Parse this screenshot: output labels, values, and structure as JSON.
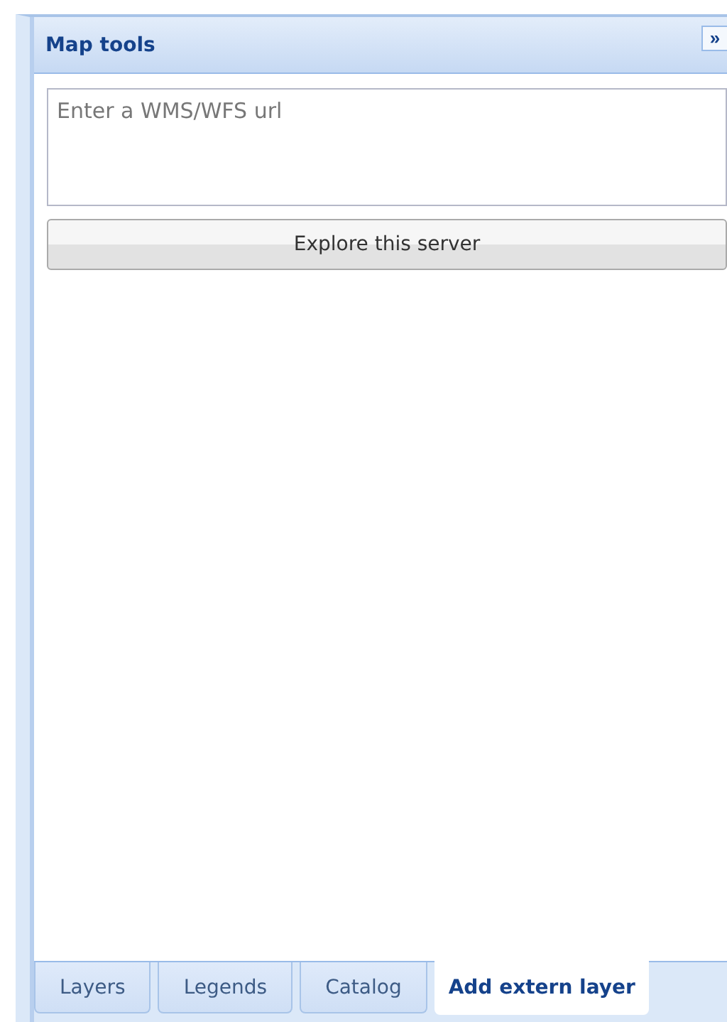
{
  "panel": {
    "title": "Map tools",
    "collapse_icon": "»"
  },
  "url_field": {
    "placeholder": "Enter a WMS/WFS url"
  },
  "explore_button": {
    "label": "Explore this server"
  },
  "tabs": [
    {
      "label": "Layers",
      "selected": false
    },
    {
      "label": "Legends",
      "selected": false
    },
    {
      "label": "Catalog",
      "selected": false
    },
    {
      "label": "Add extern layer",
      "selected": true
    }
  ]
}
